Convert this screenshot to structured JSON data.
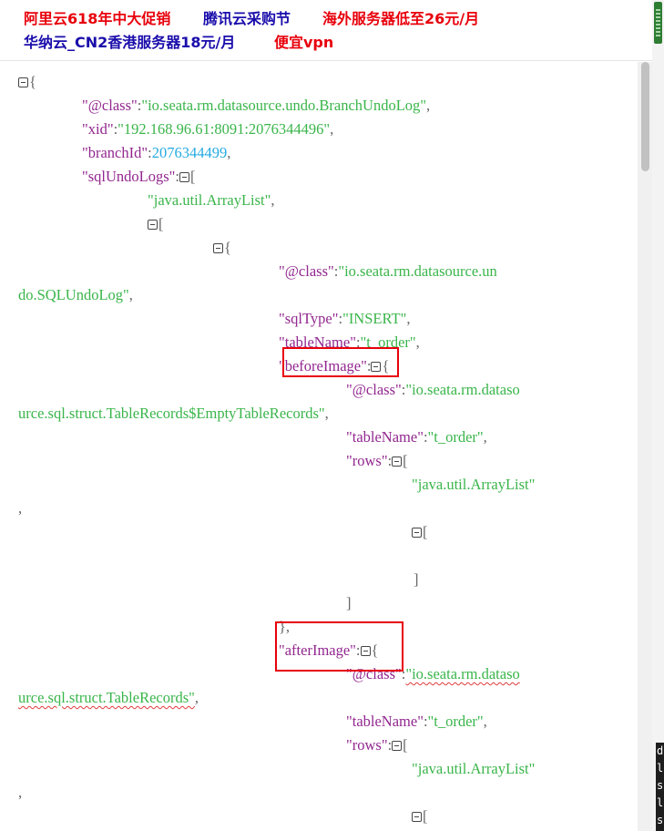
{
  "ads": {
    "row1": [
      "阿里云618年中大促销",
      "腾讯云采购节",
      "海外服务器低至26元/月"
    ],
    "row2": [
      "华纳云_CN2香港服务器18元/月",
      "便宜vpn"
    ]
  },
  "json_view": {
    "open_brace": "{",
    "class_key": "\"@class\"",
    "class_val": "\"io.seata.rm.datasource.undo.BranchUndoLog\"",
    "xid_key": "\"xid\"",
    "xid_val": "\"192.168.96.61:8091:2076344496\"",
    "branch_key": "\"branchId\"",
    "branch_val": "2076344499",
    "sql_logs_key": "\"sqlUndoLogs\"",
    "open_bracket": "[",
    "arraylist": "\"java.util.ArrayList\"",
    "inner_class_val_1": "\"io.seata.rm.datasource.un",
    "inner_class_val_2": "do.SQLUndoLog\"",
    "sqltype_key": "\"sqlType\"",
    "sqltype_val": "\"INSERT\"",
    "tablename_key": "\"tableName\"",
    "tablename_val": "\"t_order\"",
    "before_key": "\"beforeImage\"",
    "before_class_val_1": "\"io.seata.rm.dataso",
    "before_class_val_2": "urce.sql.struct.TableRecords$EmptyTableRecords\"",
    "rows_key": "\"rows\"",
    "arraylist_short": "\"java.util.ArrayList\"",
    "comma": ",",
    "close_bracket": "]",
    "close_brace_comma": "},",
    "after_key": "\"afterImage\"",
    "after_class_val_1": "\"io.seata.rm.dataso",
    "after_class_val_2": "urce.sql.struct.TableRecords\""
  },
  "console_lines": [
    "d",
    "l",
    "s",
    "l",
    "s"
  ],
  "colors": {
    "key": "#92278f",
    "string": "#3ab54a",
    "number": "#25aae1",
    "highlight": "#e8000b"
  }
}
